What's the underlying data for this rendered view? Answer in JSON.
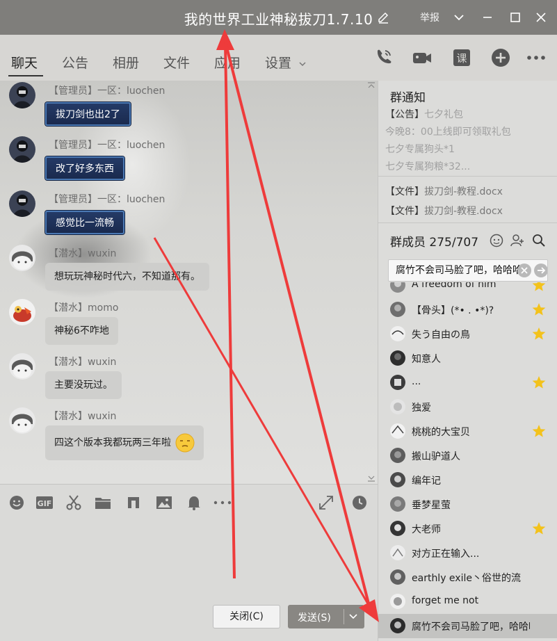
{
  "window": {
    "title": "我的世界工业神秘拔刀1.7.10",
    "report_label": "举报"
  },
  "tabs": [
    {
      "label": "聊天",
      "active": true
    },
    {
      "label": "公告"
    },
    {
      "label": "相册"
    },
    {
      "label": "文件"
    },
    {
      "label": "应用"
    },
    {
      "label": "设置"
    }
  ],
  "header_icons": [
    "phone-icon",
    "video-icon",
    "class-icon",
    "add-icon",
    "more-icon"
  ],
  "messages": [
    {
      "sender": "【管理员】一区：luochen",
      "text": "拔刀剑也出2了",
      "style": "admin"
    },
    {
      "sender": "【管理员】一区：luochen",
      "text": "改了好多东西",
      "style": "admin"
    },
    {
      "sender": "【管理员】一区：luochen",
      "text": "感觉比一流畅",
      "style": "admin"
    },
    {
      "sender": "【潜水】wuxin",
      "text": "想玩玩神秘时代六，不知道那有。",
      "style": "normal"
    },
    {
      "sender": "【潜水】momo",
      "text": "神秘6不咋地",
      "style": "normal"
    },
    {
      "sender": "【潜水】wuxin",
      "text": "主要没玩过。",
      "style": "normal"
    },
    {
      "sender": "【潜水】wuxin",
      "text": "四这个版本我都玩两三年啦",
      "style": "normal",
      "emoji": "smug-face-emoji"
    }
  ],
  "toolbar_icons": [
    "emoji-icon",
    "gif-icon",
    "screenshot-icon",
    "folder-icon",
    "music-icon",
    "image-icon",
    "bell-icon",
    "more-icon",
    "expand-icon",
    "history-icon"
  ],
  "buttons": {
    "close": "关闭(C)",
    "send": "发送(S)"
  },
  "notice": {
    "title": "群通知",
    "tag": "【公告】",
    "headline": "七夕礼包",
    "lines": [
      "今晚8：00上线即可领取礼包",
      "七夕专属狗头*1",
      "七夕专属狗粮*32..."
    ],
    "files": [
      {
        "tag": "【文件】",
        "name": "拔刀剑-教程.docx"
      },
      {
        "tag": "【文件】",
        "name": "拔刀剑-教程.docx"
      }
    ]
  },
  "members": {
    "title": "群成员 275/707",
    "search_value": "腐竹不会司马脸了吧，哈哈哈",
    "list": [
      {
        "name": "A freedom of him",
        "star": true
      },
      {
        "name": "【骨头】(*• . •*)?",
        "star": true
      },
      {
        "name": "失う自由の鳥",
        "star": true
      },
      {
        "name": "知意人",
        "star": false
      },
      {
        "name": "...",
        "star": true
      },
      {
        "name": "独爱",
        "star": false
      },
      {
        "name": "桃桃的大宝贝",
        "star": true
      },
      {
        "name": "搬山驴道人",
        "star": false
      },
      {
        "name": "编年记",
        "star": false
      },
      {
        "name": "垂梦星萤",
        "star": false
      },
      {
        "name": "大老师",
        "star": true
      },
      {
        "name": "对方正在输入...",
        "star": false
      },
      {
        "name": "earthly exile丶俗世的流",
        "star": false
      },
      {
        "name": "forget me not",
        "star": false
      },
      {
        "name": "腐竹不会司马脸了吧，哈哈哈",
        "star": false,
        "selected": true
      }
    ]
  },
  "colors": {
    "titlebar": "#7f7e7b",
    "admin_bubble": "#1f3158",
    "star": "#f3c21b",
    "annotation_arrow": "#ee3b3b"
  }
}
